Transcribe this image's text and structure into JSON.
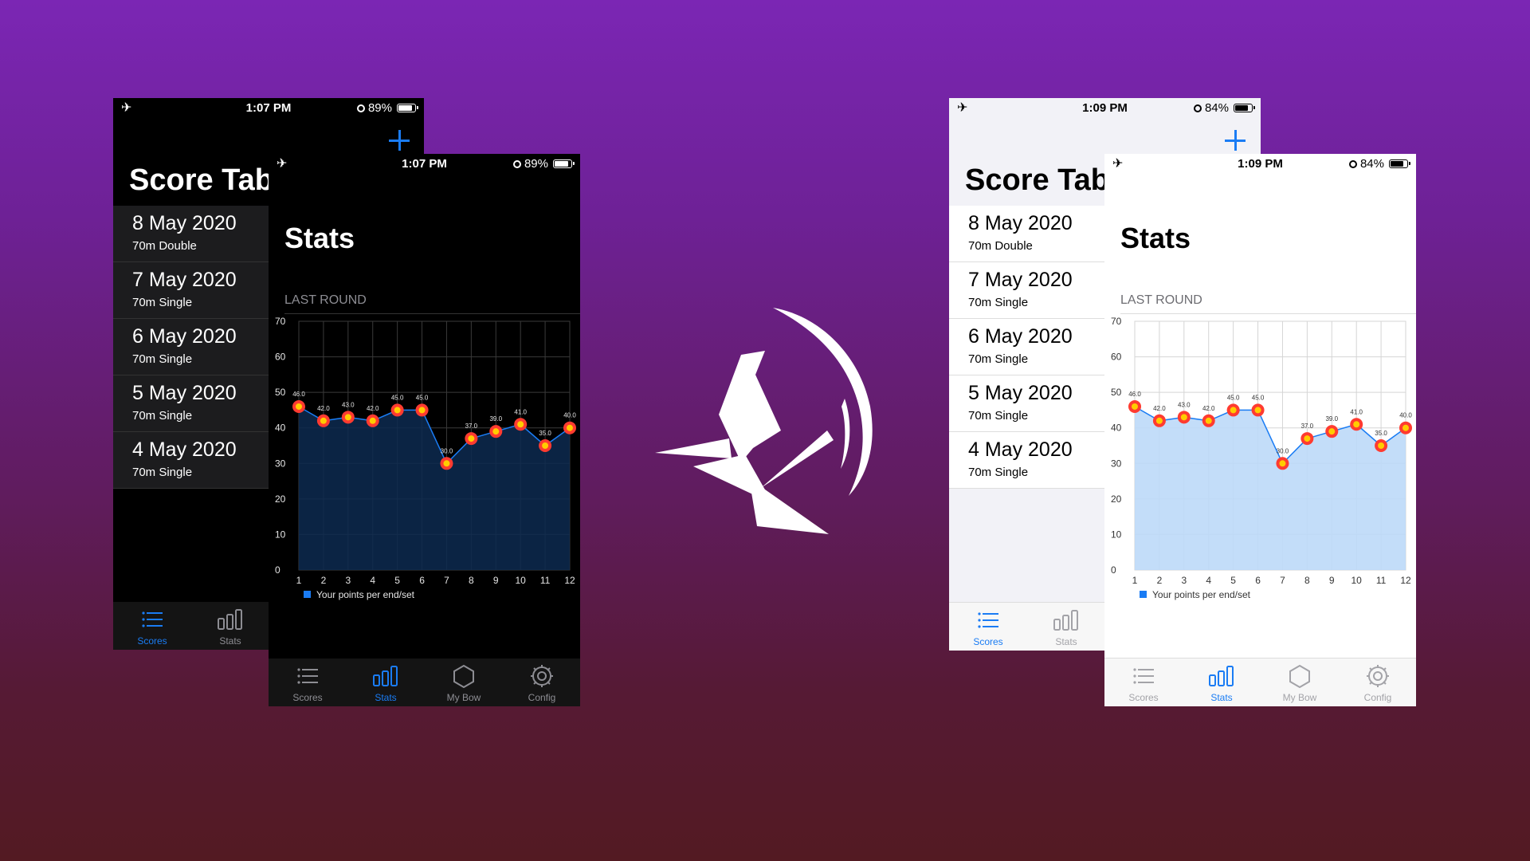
{
  "dark": {
    "back_status": {
      "time": "1:07 PM",
      "battery": "89%"
    },
    "front_status": {
      "time": "1:07 PM",
      "battery": "89%"
    },
    "scores_title": "Score Tabl",
    "stats_title": "Stats",
    "section": "LAST ROUND",
    "rows": [
      {
        "date": "8 May 2020",
        "sub": "70m Double"
      },
      {
        "date": "7 May 2020",
        "sub": "70m Single"
      },
      {
        "date": "6 May 2020",
        "sub": "70m Single"
      },
      {
        "date": "5 May 2020",
        "sub": "70m Single"
      },
      {
        "date": "4 May 2020",
        "sub": "70m Single"
      }
    ],
    "back_tabs": [
      "Scores",
      "Stats"
    ],
    "front_tabs": [
      "Scores",
      "Stats",
      "My Bow",
      "Config"
    ]
  },
  "light": {
    "back_status": {
      "time": "1:09 PM",
      "battery": "84%"
    },
    "front_status": {
      "time": "1:09 PM",
      "battery": "84%"
    },
    "scores_title": "Score Tabl",
    "stats_title": "Stats",
    "section": "LAST ROUND",
    "rows": [
      {
        "date": "8 May 2020",
        "sub": "70m Double"
      },
      {
        "date": "7 May 2020",
        "sub": "70m Single"
      },
      {
        "date": "6 May 2020",
        "sub": "70m Single"
      },
      {
        "date": "5 May 2020",
        "sub": "70m Single"
      },
      {
        "date": "4 May 2020",
        "sub": "70m Single"
      }
    ],
    "back_tabs": [
      "Scores",
      "Stats"
    ],
    "front_tabs": [
      "Scores",
      "Stats",
      "My Bow",
      "Config"
    ]
  },
  "chart_data": [
    {
      "type": "area",
      "theme": "dark",
      "categories": [
        "1",
        "2",
        "3",
        "4",
        "5",
        "6",
        "7",
        "8",
        "9",
        "10",
        "11",
        "12"
      ],
      "series": [
        {
          "name": "Your points per end/set",
          "values": [
            46,
            42,
            43,
            42,
            45,
            45,
            30,
            37,
            39,
            41,
            35,
            40
          ],
          "labels": [
            "46.0",
            "42.0",
            "43.0",
            "42.0",
            "45.0",
            "45.0",
            "30.0",
            "37.0",
            "39.0",
            "41.0",
            "35.0",
            "40.0"
          ]
        }
      ],
      "yticks": [
        "0",
        "10",
        "20",
        "30",
        "40",
        "50",
        "60",
        "70"
      ],
      "ylim": [
        0,
        70
      ],
      "grid": true,
      "legend": "bottom-left",
      "colors": {
        "line": "#1a7cf4",
        "fill": "#0d2a50",
        "marker_outer": "#ff3b30",
        "marker_inner": "#ffcc00"
      }
    },
    {
      "type": "area",
      "theme": "light",
      "categories": [
        "1",
        "2",
        "3",
        "4",
        "5",
        "6",
        "7",
        "8",
        "9",
        "10",
        "11",
        "12"
      ],
      "series": [
        {
          "name": "Your points per end/set",
          "values": [
            46,
            42,
            43,
            42,
            45,
            45,
            30,
            37,
            39,
            41,
            35,
            40
          ],
          "labels": [
            "46.0",
            "42.0",
            "43.0",
            "42.0",
            "45.0",
            "45.0",
            "30.0",
            "37.0",
            "39.0",
            "41.0",
            "35.0",
            "40.0"
          ]
        }
      ],
      "yticks": [
        "0",
        "10",
        "20",
        "30",
        "40",
        "50",
        "60",
        "70"
      ],
      "ylim": [
        0,
        70
      ],
      "grid": true,
      "legend": "bottom-left",
      "colors": {
        "line": "#1a7cf4",
        "fill": "#bcd9f8",
        "marker_outer": "#ff3b30",
        "marker_inner": "#ffcc00"
      }
    }
  ],
  "icons": [
    "airplane-icon",
    "orientation-lock-icon",
    "battery-icon",
    "add-icon",
    "list-icon",
    "bar-chart-icon",
    "hexagon-icon",
    "gear-icon",
    "app-logo"
  ]
}
